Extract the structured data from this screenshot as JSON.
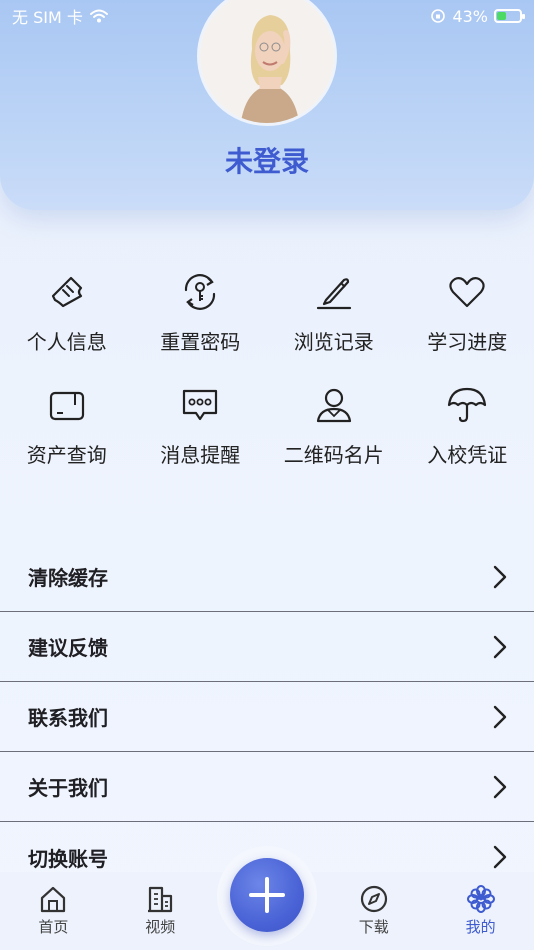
{
  "status_bar": {
    "carrier": "无 SIM 卡",
    "battery_text": "43%",
    "battery_level": 0.43,
    "battery_color": "#4cd964"
  },
  "profile": {
    "username": "未登录",
    "name_color": "#3e5bd0"
  },
  "grid": [
    {
      "label": "个人信息",
      "icon": "ticket-icon"
    },
    {
      "label": "重置密码",
      "icon": "key-reset-icon"
    },
    {
      "label": "浏览记录",
      "icon": "pen-icon"
    },
    {
      "label": "学习进度",
      "icon": "heart-icon"
    },
    {
      "label": "资产查询",
      "icon": "wallet-icon"
    },
    {
      "label": "消息提醒",
      "icon": "chat-bubble-icon"
    },
    {
      "label": "二维码名片",
      "icon": "user-icon"
    },
    {
      "label": "入校凭证",
      "icon": "umbrella-icon"
    }
  ],
  "list": [
    {
      "label": "清除缓存"
    },
    {
      "label": "建议反馈"
    },
    {
      "label": "联系我们"
    },
    {
      "label": "关于我们"
    },
    {
      "label": "切换账号"
    }
  ],
  "tabbar": {
    "tabs": [
      {
        "label": "首页",
        "icon": "home-icon"
      },
      {
        "label": "视频",
        "icon": "building-icon"
      },
      {
        "label": "",
        "icon": "plus-icon"
      },
      {
        "label": "下载",
        "icon": "compass-icon"
      },
      {
        "label": "我的",
        "icon": "flower-icon"
      }
    ],
    "active_index": 4,
    "accent": "#3e5bd0"
  }
}
